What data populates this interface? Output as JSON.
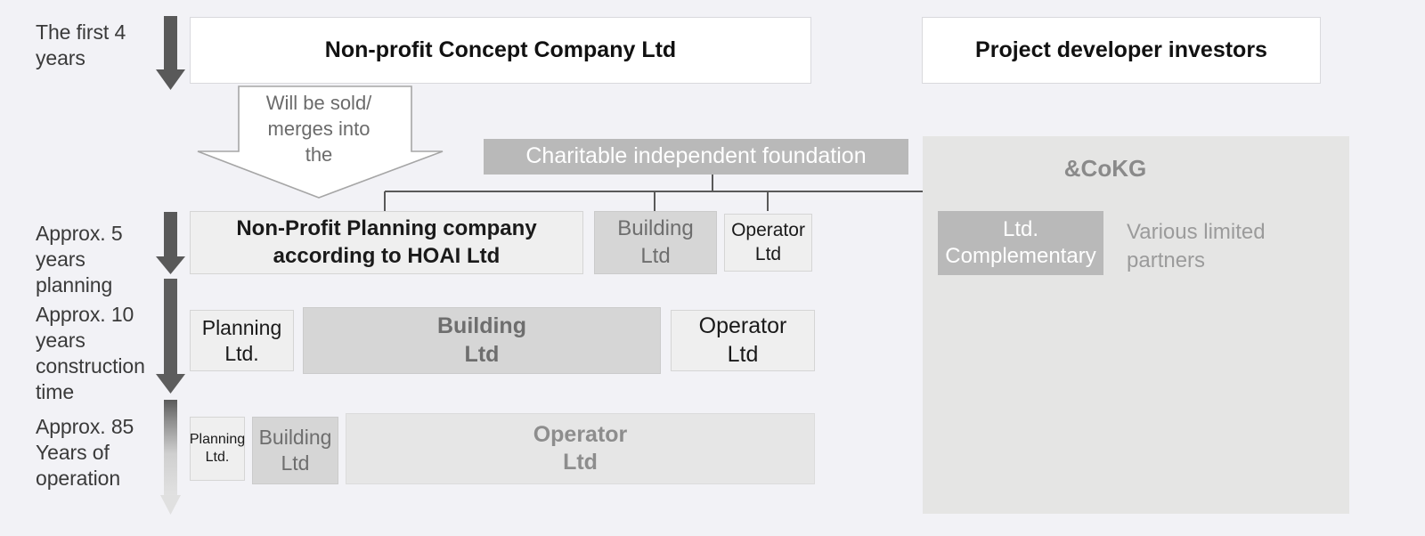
{
  "background_color": "#f2f2f6",
  "timeline": {
    "phases": [
      {
        "label": "The first 4\nyears"
      },
      {
        "label": "Approx. 5\nyears\nplanning"
      },
      {
        "label": "Approx. 10\nyears\nconstruction\ntime"
      },
      {
        "label": "Approx. 85\nYears of\noperation"
      }
    ],
    "arrow_color_dark": "#595959",
    "arrow_color_fade": "#d9d9d9"
  },
  "top_row": {
    "concept_company": "Non-profit Concept Company Ltd",
    "investors": "Project developer investors"
  },
  "callout": {
    "text": "Will be sold/\nmerges into\nthe",
    "shape": "down-arrow-callout"
  },
  "foundation": {
    "label": "Charitable independent  foundation",
    "color": "#b9b9b9"
  },
  "row_planning": {
    "boxes": [
      {
        "label": "Non-Profit Planning company\naccording to HOAI Ltd",
        "style": "lightgrey",
        "bold": true
      },
      {
        "label": "Building\nLtd",
        "style": "midgrey"
      },
      {
        "label": "Operator\nLtd",
        "style": "lightgrey"
      }
    ]
  },
  "row_construction": {
    "boxes": [
      {
        "label": "Planning\nLtd.",
        "style": "lightgrey"
      },
      {
        "label": "Building\nLtd",
        "style": "midgrey"
      },
      {
        "label": "Operator\nLtd",
        "style": "lightgrey"
      }
    ]
  },
  "row_operation": {
    "boxes": [
      {
        "label": "Planning\nLtd.",
        "style": "lightgrey"
      },
      {
        "label": "Building\nLtd",
        "style": "midgrey"
      },
      {
        "label": "Operator\nLtd",
        "style": "palegrey"
      }
    ]
  },
  "cokg_panel": {
    "title": "&CoKG",
    "complementary": "Ltd.\nComplementary",
    "partners": "Various limited\npartners"
  }
}
